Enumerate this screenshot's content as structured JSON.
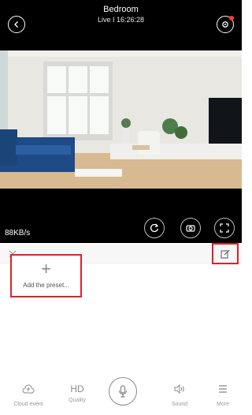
{
  "header": {
    "title": "Bedroom",
    "subtitle": "Live I 16:26:28"
  },
  "video": {
    "bitrate": "88KB/s"
  },
  "presets": {
    "add_label": "Add the preset..."
  },
  "bottom_nav": {
    "cloud_event": "Cloud event",
    "hd": "HD",
    "quality": "Quality",
    "sound": "Sound",
    "more": "More"
  },
  "colors": {
    "highlight": "#e0202c",
    "background_dark": "#000000"
  },
  "icons": [
    "back-icon",
    "settings-icon",
    "rotate-icon",
    "camera-icon",
    "fullscreen-icon",
    "close-icon",
    "edit-icon",
    "cloud-icon",
    "mic-icon",
    "sound-icon",
    "menu-icon"
  ]
}
